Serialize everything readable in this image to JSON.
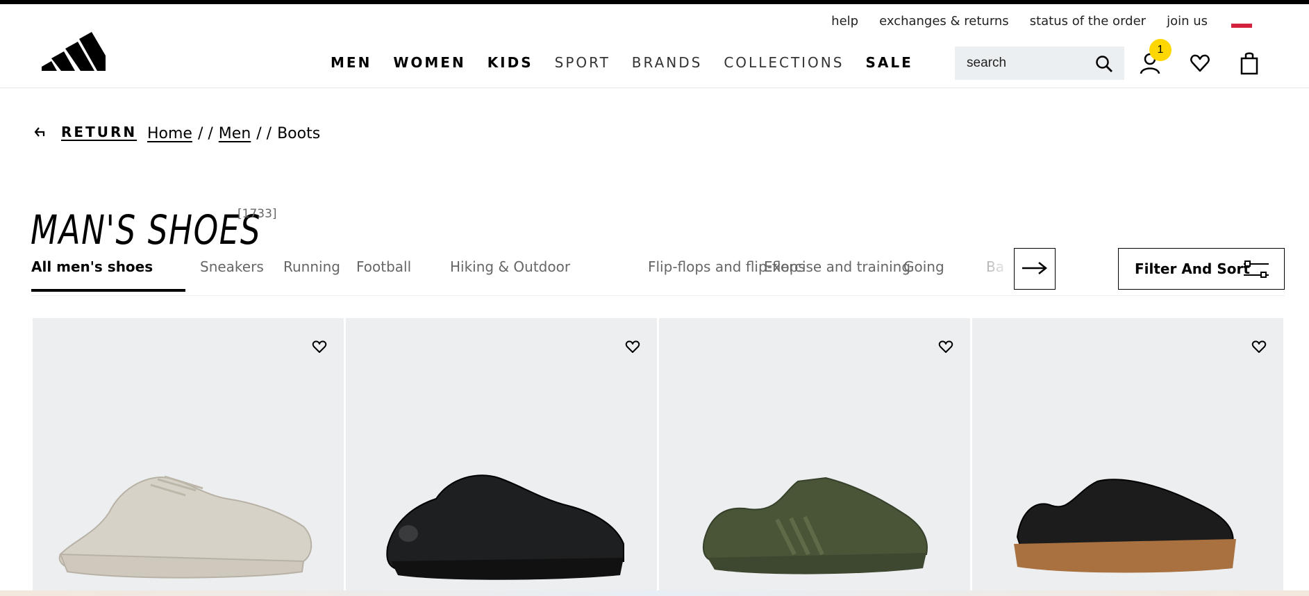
{
  "utility_nav": [
    "help",
    "exchanges & returns",
    "status of the order",
    "join us"
  ],
  "main_nav": [
    {
      "label": "MEN",
      "style": "bold"
    },
    {
      "label": "WOMEN",
      "style": "bold"
    },
    {
      "label": "KIDS",
      "style": "bold"
    },
    {
      "label": "SPORT",
      "style": "light"
    },
    {
      "label": "BRANDS",
      "style": "light"
    },
    {
      "label": "COLLECTIONS",
      "style": "light"
    },
    {
      "label": "SALE",
      "style": "bold"
    }
  ],
  "search": {
    "placeholder": "search"
  },
  "account": {
    "badge_count": "1",
    "badge_color": "#ffd700"
  },
  "breadcrumb": {
    "return_label": "RETURN",
    "items": [
      "Home",
      "Men",
      "Boots"
    ],
    "separator": "/ /"
  },
  "page": {
    "title": "MAN'S SHOES",
    "count": "[1733]"
  },
  "categories": {
    "active": "All men's shoes",
    "items": [
      "Sneakers",
      "Running",
      "Football",
      "Hiking & Outdoor",
      "Flip-flops and flip-flops",
      "Exercise and training",
      "Going",
      "Ba"
    ]
  },
  "filter": {
    "label": "Filter And Sort"
  },
  "products": [
    {
      "name": "beige sneaker",
      "color": "#d7d2c8"
    },
    {
      "name": "black sneaker",
      "color": "#1e1f20"
    },
    {
      "name": "olive sneaker",
      "color": "#4a5538"
    },
    {
      "name": "black suede sneaker gum sole",
      "color": "#1c1c1c"
    }
  ],
  "colors": {
    "card_bg": "#eceef0",
    "accent": "#ffd700",
    "flag_red": "#d4213d"
  }
}
